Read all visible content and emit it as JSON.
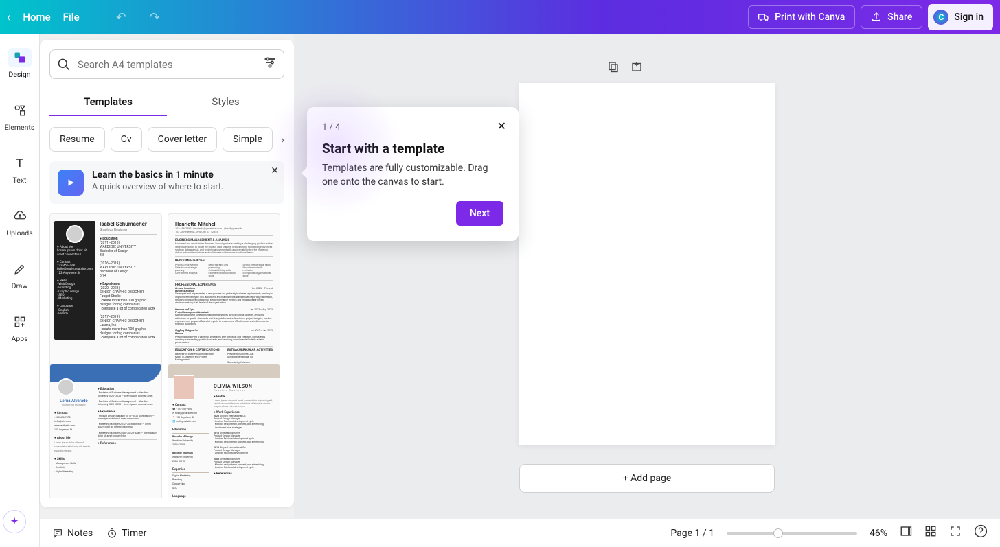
{
  "topbar": {
    "home": "Home",
    "file": "File",
    "print": "Print with Canva",
    "share": "Share",
    "signin": "Sign in"
  },
  "rail": {
    "design": "Design",
    "elements": "Elements",
    "text": "Text",
    "uploads": "Uploads",
    "draw": "Draw",
    "apps": "Apps"
  },
  "panel": {
    "search_placeholder": "Search A4 templates",
    "tab_templates": "Templates",
    "tab_styles": "Styles",
    "chips": {
      "resume": "Resume",
      "cv": "Cv",
      "cover": "Cover letter",
      "simple": "Simple"
    },
    "learn_title": "Learn the basics in 1 minute",
    "learn_sub": "A quick overview of where to start.",
    "t1_name": "Isabel Schumacher",
    "t1_sub": "Graphics Designer",
    "t2_name": "Henrietta Mitchell",
    "t3_name": "Lorna Alvarado",
    "t3_sub": "Marketing Manager",
    "t4_name": "OLIVIA WILSON",
    "t4_sub": "Graphic Designer"
  },
  "popover": {
    "step": "1 / 4",
    "title": "Start with a template",
    "body": "Templates are fully customizable. Drag one onto the canvas to start.",
    "next": "Next"
  },
  "canvas": {
    "addpage": "+ Add page"
  },
  "bottom": {
    "notes": "Notes",
    "timer": "Timer",
    "page_counter": "Page 1 / 1",
    "zoom": "46%"
  }
}
